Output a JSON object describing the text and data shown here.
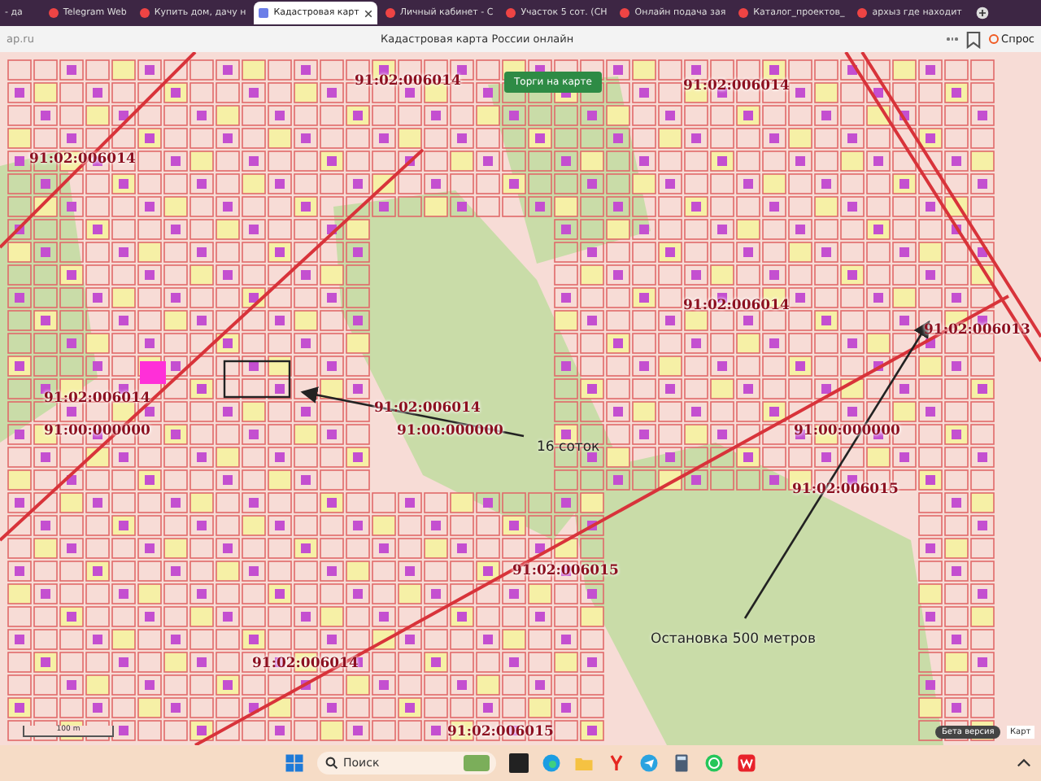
{
  "browser": {
    "tabs": [
      {
        "title": "- да",
        "selected": false
      },
      {
        "title": "Telegram Web",
        "selected": false
      },
      {
        "title": "Купить дом, дачу н",
        "selected": false
      },
      {
        "title": "Кадастровая карт",
        "selected": true
      },
      {
        "title": "Личный кабинет - С",
        "selected": false
      },
      {
        "title": "Участок 5 сот. (СН",
        "selected": false
      },
      {
        "title": "Онлайн подача зая",
        "selected": false
      },
      {
        "title": "Каталог_проектов_",
        "selected": false
      },
      {
        "title": "архыз где находит",
        "selected": false
      }
    ],
    "address": "ap.ru",
    "page_title": "Кадастровая карта России онлайн",
    "ask_button": "Спрос"
  },
  "map": {
    "trade_button": "Торги на карте",
    "labels": [
      {
        "text": "91:02:006014",
        "kind": "cadastral"
      },
      {
        "text": "91:02:006014",
        "kind": "cadastral"
      },
      {
        "text": "91:02:006014",
        "kind": "cadastral"
      },
      {
        "text": "91:02:006014",
        "kind": "cadastral"
      },
      {
        "text": "91:02:006013",
        "kind": "cadastral"
      },
      {
        "text": "91:02:006014",
        "kind": "cadastral"
      },
      {
        "text": "91:00:000000",
        "kind": "cadastral"
      },
      {
        "text": "91:02:006014",
        "kind": "cadastral"
      },
      {
        "text": "91:00:000000",
        "kind": "cadastral"
      },
      {
        "text": "16 соток",
        "kind": "note"
      },
      {
        "text": "91:00:000000",
        "kind": "cadastral"
      },
      {
        "text": "91:02:006015",
        "kind": "cadastral"
      },
      {
        "text": "91:02:006015",
        "kind": "cadastral"
      },
      {
        "text": "Остановка 500 метров",
        "kind": "note"
      },
      {
        "text": "91:02:006014",
        "kind": "cadastral"
      },
      {
        "text": "91:02:006015",
        "kind": "cadastral"
      }
    ],
    "scale": "100 m",
    "beta_badge": "Бета версия",
    "map_type": "Карт"
  },
  "taskbar": {
    "search_placeholder": "Поиск"
  }
}
